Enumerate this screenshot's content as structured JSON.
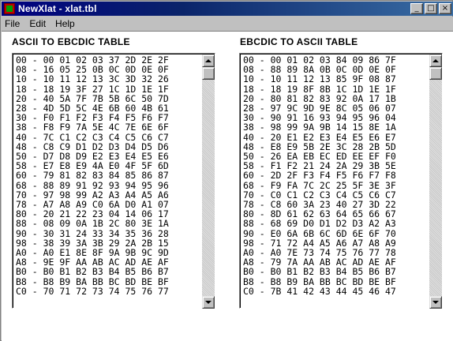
{
  "window": {
    "title": "NewXlat - xlat.tbl",
    "minimize_glyph": "_",
    "maximize_glyph": "□",
    "close_glyph": "×"
  },
  "menu": {
    "items": [
      "File",
      "Edit",
      "Help"
    ]
  },
  "left_table": {
    "title": "ASCII TO EBCDIC TABLE",
    "rows": [
      "00 - 00 01 02 03 37 2D 2E 2F",
      "08 - 16 05 25 0B 0C 0D 0E 0F",
      "10 - 10 11 12 13 3C 3D 32 26",
      "18 - 18 19 3F 27 1C 1D 1E 1F",
      "20 - 40 5A 7F 7B 5B 6C 50 7D",
      "28 - 4D 5D 5C 4E 6B 60 4B 61",
      "30 - F0 F1 F2 F3 F4 F5 F6 F7",
      "38 - F8 F9 7A 5E 4C 7E 6E 6F",
      "40 - 7C C1 C2 C3 C4 C5 C6 C7",
      "48 - C8 C9 D1 D2 D3 D4 D5 D6",
      "50 - D7 D8 D9 E2 E3 E4 E5 E6",
      "58 - E7 E8 E9 4A E0 4F 5F 6D",
      "60 - 79 81 82 83 84 85 86 87",
      "68 - 88 89 91 92 93 94 95 96",
      "70 - 97 98 99 A2 A3 A4 A5 A6",
      "78 - A7 A8 A9 C0 6A D0 A1 07",
      "80 - 20 21 22 23 04 14 06 17",
      "88 - 08 09 0A 1B 2C 80 3E 1A",
      "90 - 30 31 24 33 34 35 36 28",
      "98 - 38 39 3A 3B 29 2A 2B 15",
      "A0 - A0 E1 8E 8F 9A 9B 9C 9D",
      "A8 - 9E 9F AA AB AC AD AE AF",
      "B0 - B0 B1 B2 B3 B4 B5 B6 B7",
      "B8 - B8 B9 BA BB BC BD BE BF",
      "C0 - 70 71 72 73 74 75 76 77"
    ]
  },
  "right_table": {
    "title": "EBCDIC TO ASCII TABLE",
    "rows": [
      "00 - 00 01 02 03 84 09 86 7F",
      "08 - 88 89 8A 0B 0C 0D 0E 0F",
      "10 - 10 11 12 13 85 9F 08 87",
      "18 - 18 19 8F 8B 1C 1D 1E 1F",
      "20 - 80 81 82 83 92 0A 17 1B",
      "28 - 97 9C 9D 9E 8C 05 06 07",
      "30 - 90 91 16 93 94 95 96 04",
      "38 - 98 99 9A 9B 14 15 8E 1A",
      "40 - 20 E1 E2 E3 E4 E5 E6 E7",
      "48 - E8 E9 5B 2E 3C 28 2B 5D",
      "50 - 26 EA EB EC ED EE EF F0",
      "58 - F1 F2 21 24 2A 29 3B 5E",
      "60 - 2D 2F F3 F4 F5 F6 F7 F8",
      "68 - F9 FA 7C 2C 25 5F 3E 3F",
      "70 - C0 C1 C2 C3 C4 C5 C6 C7",
      "78 - C8 60 3A 23 40 27 3D 22",
      "80 - 8D 61 62 63 64 65 66 67",
      "88 - 68 69 D0 D1 D2 D3 A2 A3",
      "90 - E0 6A 6B 6C 6D 6E 6F 70",
      "98 - 71 72 A4 A5 A6 A7 A8 A9",
      "A0 - A0 7E 73 74 75 76 77 78",
      "A8 - 79 7A AA AB AC AD AE AF",
      "B0 - B0 B1 B2 B3 B4 B5 B6 B7",
      "B8 - B8 B9 BA BB BC BD BE BF",
      "C0 - 7B 41 42 43 44 45 46 47"
    ]
  },
  "colors": {
    "titlebar_start": "#000080",
    "titlebar_end": "#3a6ea5",
    "face": "#c0c0c0"
  }
}
